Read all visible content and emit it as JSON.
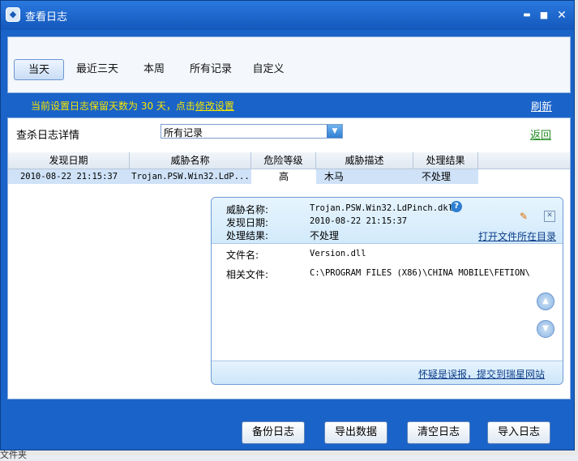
{
  "window": {
    "title": "查看日志",
    "minimize": "▬",
    "maximize": "■",
    "close": "✕"
  },
  "tabs": [
    {
      "label": "当天",
      "active": true
    },
    {
      "label": "最近三天",
      "active": false
    },
    {
      "label": "本周",
      "active": false
    },
    {
      "label": "所有记录",
      "active": false
    },
    {
      "label": "自定义",
      "active": false
    }
  ],
  "notice": {
    "text": "当前设置日志保留天数为 30 天，点击",
    "link": "修改设置"
  },
  "refresh_label": "刷新",
  "detail": {
    "label": "查杀日志详情",
    "select_value": "所有记录",
    "back_label": "返回"
  },
  "table": {
    "headers": [
      "发现日期",
      "威胁名称",
      "危险等级",
      "威胁描述",
      "处理结果"
    ],
    "rows": [
      [
        "2010-08-22 21:15:37",
        "Trojan.PSW.Win32.LdP...",
        "高",
        "木马",
        "不处理"
      ]
    ]
  },
  "popup": {
    "threat_name_label": "威胁名称:",
    "threat_name": "Trojan.PSW.Win32.LdPinch.dkl",
    "found_date_label": "发现日期:",
    "found_date": "2010-08-22 21:15:37",
    "result_label": "处理结果:",
    "result": "不处理",
    "open_dir_label": "打开文件所在目录",
    "file_name_label": "文件名:",
    "file_name": "Version.dll",
    "related_file_label": "相关文件:",
    "related_file": "C:\\PROGRAM FILES (X86)\\CHINA MOBILE\\FETION\\",
    "report_label": "怀疑是误报，提交到瑞星网站"
  },
  "buttons": {
    "backup": "备份日志",
    "export": "导出数据",
    "clear": "清空日志",
    "import": "导入日志"
  },
  "background": {
    "bottom_text": "文件夹"
  },
  "colors": {
    "window_bg": "#1a63c8",
    "notice": "#f5e600",
    "back_link": "#218b21",
    "selected_row": "#cfe2f7"
  }
}
